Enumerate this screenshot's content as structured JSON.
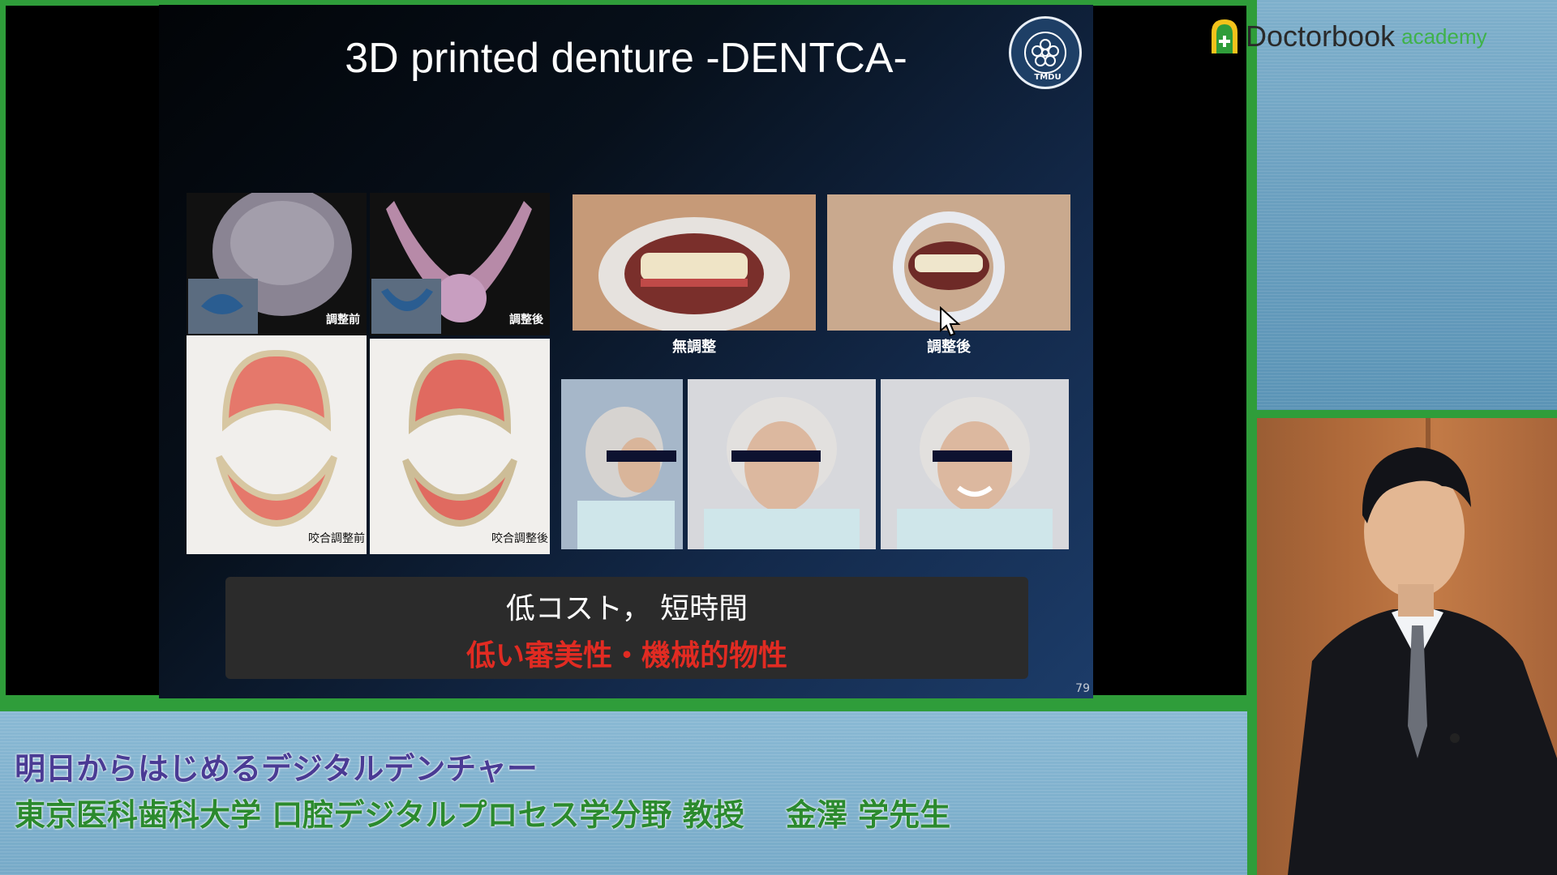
{
  "slide": {
    "title": "3D printed denture -DENTCA-",
    "seal_text": "TMDU",
    "captions": {
      "before_adjust": "調整前",
      "after_adjust": "調整後",
      "occlusal_before": "咬合調整前",
      "occlusal_after": "咬合調整後",
      "no_adjust": "無調整",
      "adjusted": "調整後"
    },
    "summary_line1": "低コスト，  短時間",
    "summary_line2": "低い審美性・機械的物性",
    "page_number": "79"
  },
  "logo": {
    "name": "Doctorbook",
    "sub": "academy",
    "icon": "doctorbook-logo-icon"
  },
  "banner": {
    "title": "明日からはじめるデジタルデンチャー",
    "speaker": "東京医科歯科大学 口腔デジタルプロセス学分野 教授　 金澤 学先生"
  },
  "colors": {
    "frame_green": "#2f9d3a",
    "emphasis_red": "#e12b22",
    "banner_title": "#4a3b94",
    "banner_speaker": "#2b8a2e"
  }
}
